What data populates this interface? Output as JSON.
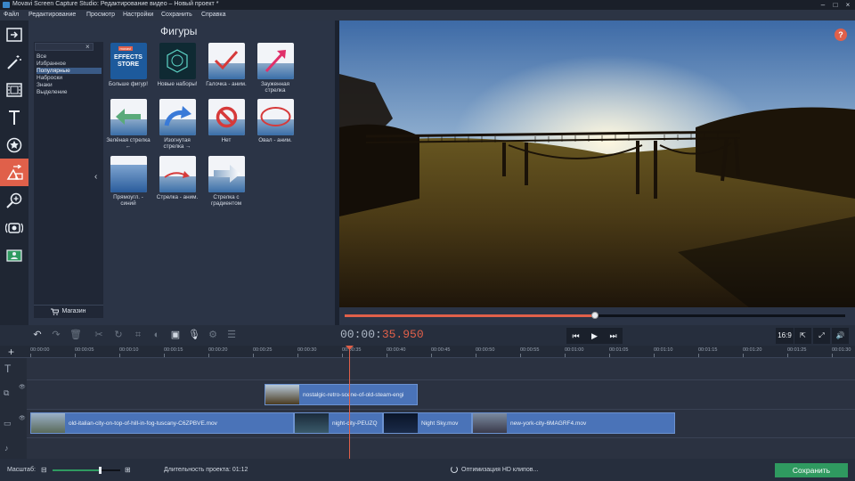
{
  "window": {
    "title": "Movavi Screen Capture Studio: Редактирование видео – Новый проект *"
  },
  "menu": [
    "Файл",
    "Редактирование",
    "Просмотр",
    "Настройки",
    "Сохранить",
    "Справка"
  ],
  "sidebar": {
    "items": [
      "import-icon",
      "magic-wand-icon",
      "filmstrip-icon",
      "titles-icon",
      "stickers-icon",
      "shapes-icon",
      "zoom-icon",
      "capture-icon",
      "presentation-icon"
    ],
    "active": "shapes-icon"
  },
  "panel": {
    "title": "Фигуры",
    "categories": [
      "Все",
      "Избранное",
      "Популярные",
      "Наброски",
      "Знаки",
      "Выделение"
    ],
    "selected_category": "Популярные",
    "shop_label": "Магазин",
    "tiles": [
      {
        "label": "Больше фигур!",
        "badge": "EFFECTS STORE",
        "badge_top": "movavi"
      },
      {
        "label": "Новые наборы!"
      },
      {
        "label": "Галочка - аним."
      },
      {
        "label": "Зауженная стрелка"
      },
      {
        "label": "Зелёная стрелка ←"
      },
      {
        "label": "Изогнутая стрелка →"
      },
      {
        "label": "Нет"
      },
      {
        "label": "Овал - аним."
      },
      {
        "label": "Прямоугл. - синий"
      },
      {
        "label": "Стрелка - аним."
      },
      {
        "label": "Стрелка с градиентом"
      }
    ]
  },
  "player": {
    "help": "?",
    "progress": 0.5,
    "timecode_main": "00:00:",
    "timecode_red": "35.950",
    "aspect": "16:9"
  },
  "ruler": [
    "00:00:00",
    "00:00:05",
    "00:00:10",
    "00:00:15",
    "00:00:20",
    "00:00:25",
    "00:00:30",
    "00:00:35",
    "00:00:40",
    "00:00:45",
    "00:00:50",
    "00:00:55",
    "00:01:00",
    "00:01:05",
    "00:01:10",
    "00:01:15",
    "00:01:20",
    "00:01:25",
    "00:01:30"
  ],
  "clips": {
    "overlay": "nostalgic-retro-scene-of-old-steam-engi",
    "main": [
      "old-italian-city-on-top-of-hill-in-fog-tuscany-C6ZPBVE.mov",
      "night-city-PEUZQ",
      "Night Sky.mov",
      "new-york-city-6MAGRF4.mov"
    ]
  },
  "status": {
    "zoom_label": "Масштаб:",
    "zoom_level": 0.7,
    "duration_label": "Длительность проекта:",
    "duration_value": "01:12",
    "hd_label": "Оптимизация HD клипов...",
    "save_label": "Сохранить"
  },
  "colors": {
    "accent": "#e0604a",
    "save": "#2f9a60",
    "clip": "#4a73b8"
  }
}
